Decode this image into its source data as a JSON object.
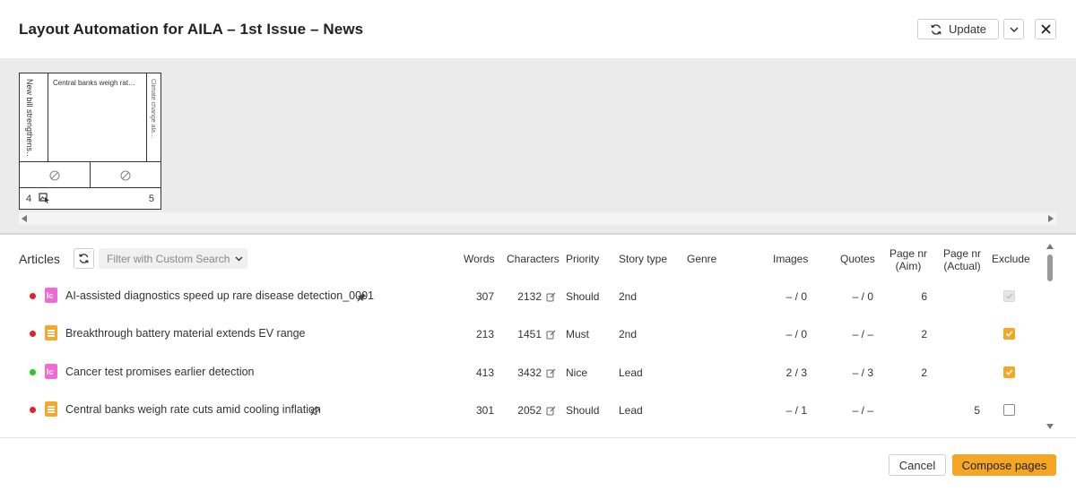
{
  "header": {
    "title": "Layout Automation for AILA – 1st Issue – News",
    "update_label": "Update"
  },
  "preview": {
    "thumb": {
      "left_article": "New bill strengthens…",
      "center_article": "Central banks weigh rat…",
      "right_article": "Climate change ala…",
      "page_left": "4",
      "page_right": "5"
    }
  },
  "articles": {
    "section_title": "Articles",
    "filter_placeholder": "Filter with Custom Search",
    "columns": {
      "words": "Words",
      "characters": "Characters",
      "priority": "Priority",
      "story_type": "Story type",
      "genre": "Genre",
      "images": "Images",
      "quotes": "Quotes",
      "page_aim_1": "Page nr",
      "page_aim_2": "(Aim)",
      "page_actual_1": "Page nr",
      "page_actual_2": "(Actual)",
      "exclude": "Exclude"
    },
    "rows": [
      {
        "status_color": "#e0222a",
        "icon": "pink",
        "title": "AI-assisted diagnostics speed up rare disease detection_0001",
        "pinned": true,
        "words": "307",
        "characters": "2132",
        "priority": "Should",
        "story_type": "2nd",
        "genre": "",
        "images": "– / 0",
        "quotes": "– / 0",
        "page_aim": "6",
        "page_actual": "",
        "exclude": "disabled"
      },
      {
        "status_color": "#e0222a",
        "icon": "orange",
        "title": "Breakthrough battery material extends EV range",
        "pinned": false,
        "words": "213",
        "characters": "1451",
        "priority": "Must",
        "story_type": "2nd",
        "genre": "",
        "images": "– / 0",
        "quotes": "– / –",
        "page_aim": "2",
        "page_actual": "",
        "exclude": "on"
      },
      {
        "status_color": "#22cc22",
        "icon": "pink",
        "title": "Cancer test promises earlier detection",
        "pinned": false,
        "words": "413",
        "characters": "3432",
        "priority": "Nice",
        "story_type": "Lead",
        "genre": "",
        "images": "2 / 3",
        "quotes": "– / 3",
        "page_aim": "2",
        "page_actual": "",
        "exclude": "on"
      },
      {
        "status_color": "#e0222a",
        "icon": "orange",
        "title": "Central banks weigh rate cuts amid cooling inflation",
        "pinned": true,
        "pin_outline": true,
        "words": "301",
        "characters": "2052",
        "priority": "Should",
        "story_type": "Lead",
        "genre": "",
        "images": "– / 1",
        "quotes": "– / –",
        "page_aim": "",
        "page_actual": "5",
        "exclude": "off"
      }
    ]
  },
  "footer": {
    "cancel_label": "Cancel",
    "compose_label": "Compose pages"
  },
  "colors": {
    "accent": "#f5a623",
    "pink_icon": "#f06bd1",
    "orange_icon": "#f7a82a"
  }
}
